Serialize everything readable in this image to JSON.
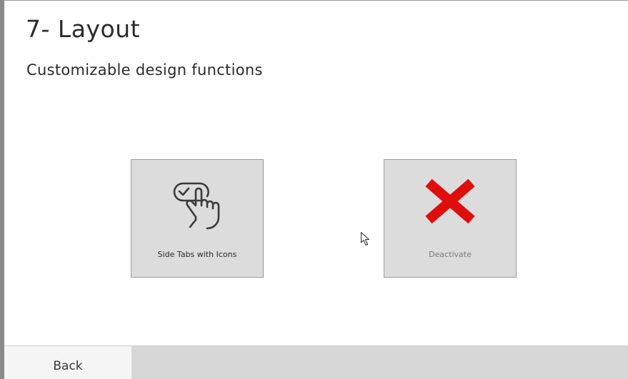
{
  "header": {
    "title": "7- Layout",
    "subtitle": "Customizable design functions"
  },
  "options": [
    {
      "label": "Side Tabs with Icons",
      "icon": "touch-toggle-icon"
    },
    {
      "label": "Deactivate",
      "icon": "red-x-icon",
      "icon_color": "#e00d0d"
    }
  ],
  "footer": {
    "back_label": "Back"
  },
  "colors": {
    "card_bg": "#dcdcdc",
    "footer_bg": "#d7d7d7",
    "deactivate_red": "#e00d0d"
  }
}
